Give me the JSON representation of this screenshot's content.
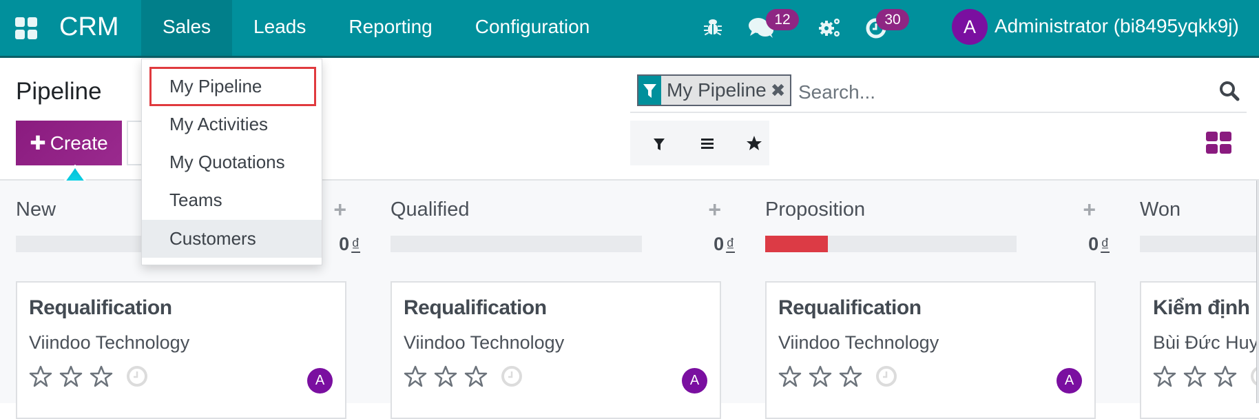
{
  "navbar": {
    "app_name": "CRM",
    "menu": [
      {
        "label": "Sales",
        "active": true
      },
      {
        "label": "Leads",
        "active": false
      },
      {
        "label": "Reporting",
        "active": false
      },
      {
        "label": "Configuration",
        "active": false
      }
    ],
    "systray": {
      "debug_icon": "bug-icon",
      "messages_icon": "comments-icon",
      "messages_count": "12",
      "settings_icon": "gears-icon",
      "activities_icon": "clock-icon",
      "activities_count": "30"
    },
    "user": {
      "avatar_initial": "A",
      "name": "Administrator (bi8495yqkk9j)"
    }
  },
  "sales_dropdown": {
    "items": [
      {
        "label": "My Pipeline",
        "highlighted": true
      },
      {
        "label": "My Activities"
      },
      {
        "label": "My Quotations"
      },
      {
        "label": "Teams"
      },
      {
        "label": "Customers",
        "hover": true
      }
    ]
  },
  "control_panel": {
    "title": "Pipeline",
    "create_label": "Create",
    "search": {
      "facet_label": "My Pipeline",
      "placeholder": "Search..."
    },
    "filter_buttons": [
      "filter-icon",
      "group-by-icon",
      "favorite-icon"
    ],
    "view": "kanban"
  },
  "kanban": {
    "currency": "₫",
    "columns": [
      {
        "title": "New",
        "total": "0",
        "progress_red": 0,
        "card": {
          "title": "Requalification",
          "subtitle": "Viindoo Technology",
          "stars": 0,
          "avatar": "A"
        }
      },
      {
        "title": "Qualified",
        "total": "0",
        "progress_red": 0,
        "card": {
          "title": "Requalification",
          "subtitle": "Viindoo Technology",
          "stars": 0,
          "avatar": "A"
        }
      },
      {
        "title": "Proposition",
        "total": "0",
        "progress_red": 0.25,
        "card": {
          "title": "Requalification",
          "subtitle": "Viindoo Technology",
          "stars": 0,
          "avatar": "A"
        }
      },
      {
        "title": "Won",
        "total": "",
        "progress_red": 0,
        "card": {
          "title": "Kiểm định",
          "subtitle": "Bùi Đức Huy",
          "stars": 0,
          "avatar": ""
        }
      }
    ]
  }
}
